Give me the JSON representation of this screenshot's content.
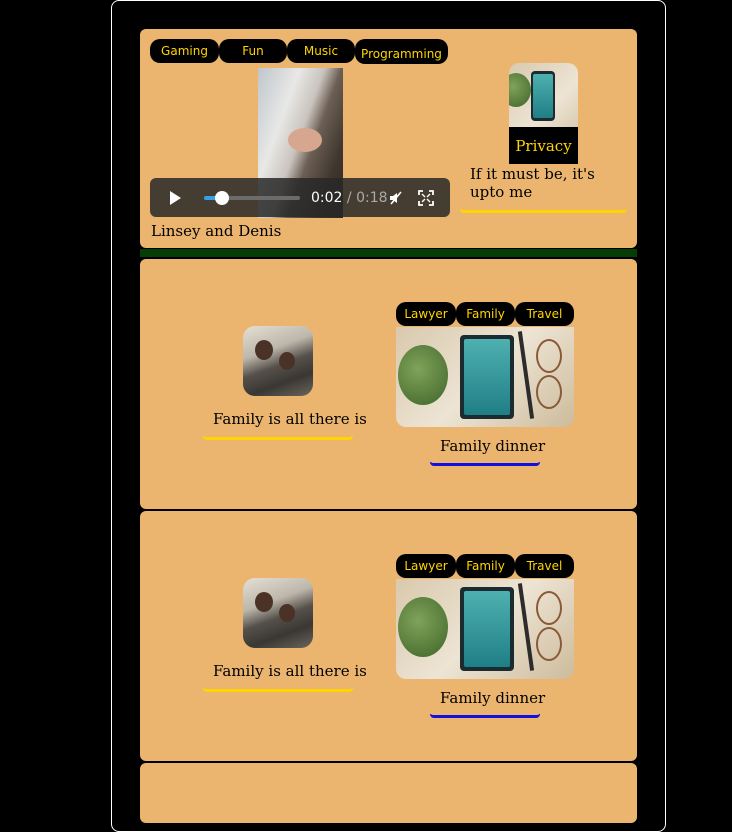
{
  "tags": {
    "top": [
      "Gaming",
      "Fun",
      "Music",
      "Programming"
    ],
    "card": [
      "Lawyer",
      "Family",
      "Travel"
    ]
  },
  "video": {
    "current_time": "0:02",
    "separator": " / ",
    "duration": "0:18",
    "progress_fraction": 0.11
  },
  "card1": {
    "video_caption": "Linsey and Denis",
    "badge_label": "Privacy",
    "side_caption": "If it must be, it's upto me"
  },
  "posts": [
    {
      "left_caption": "Family is all there is",
      "right_caption": "Family dinner"
    },
    {
      "left_caption": "Family is all there is",
      "right_caption": "Family dinner"
    }
  ],
  "colors": {
    "card_bg": "#ebb56f",
    "tag_text": "#ffd400",
    "divider": "#053d05",
    "underline_gold": "#ffd400",
    "underline_blue": "#1010e0"
  },
  "icons": [
    "play-icon",
    "mute-icon",
    "fullscreen-icon"
  ]
}
